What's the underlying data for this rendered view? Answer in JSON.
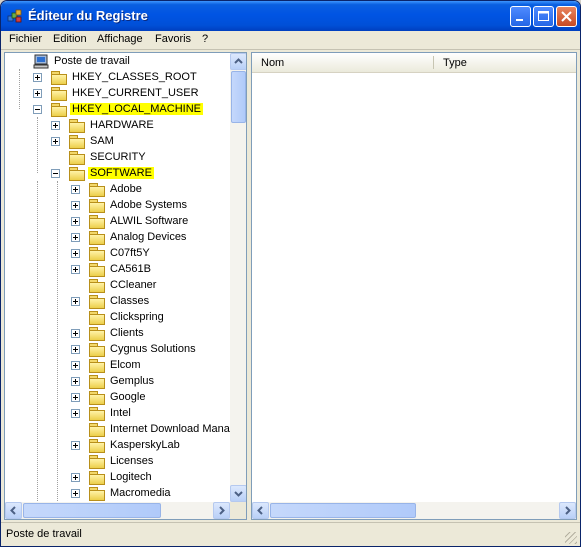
{
  "window": {
    "title": "Éditeur du Registre"
  },
  "menu": [
    "Fichier",
    "Edition",
    "Affichage",
    "Favoris",
    "?"
  ],
  "tree": {
    "root": "Poste de travail",
    "hives": [
      {
        "label": "HKEY_CLASSES_ROOT",
        "expanded": false,
        "highlighted": false
      },
      {
        "label": "HKEY_CURRENT_USER",
        "expanded": false,
        "highlighted": false
      },
      {
        "label": "HKEY_LOCAL_MACHINE",
        "expanded": true,
        "highlighted": true
      }
    ],
    "hklm_children": [
      {
        "label": "HARDWARE",
        "expandable": true,
        "expanded": false,
        "highlighted": false
      },
      {
        "label": "SAM",
        "expandable": true,
        "expanded": false,
        "highlighted": false
      },
      {
        "label": "SECURITY",
        "expandable": false,
        "expanded": false,
        "highlighted": false
      },
      {
        "label": "SOFTWARE",
        "expandable": true,
        "expanded": true,
        "highlighted": true
      }
    ],
    "software_children": [
      {
        "label": "Adobe",
        "expandable": true
      },
      {
        "label": "Adobe Systems",
        "expandable": true
      },
      {
        "label": "ALWIL Software",
        "expandable": true
      },
      {
        "label": "Analog Devices",
        "expandable": true
      },
      {
        "label": "C07ft5Y",
        "expandable": true
      },
      {
        "label": "CA561B",
        "expandable": true
      },
      {
        "label": "CCleaner",
        "expandable": false
      },
      {
        "label": "Classes",
        "expandable": true
      },
      {
        "label": "Clickspring",
        "expandable": false
      },
      {
        "label": "Clients",
        "expandable": true
      },
      {
        "label": "Cygnus Solutions",
        "expandable": true
      },
      {
        "label": "Elcom",
        "expandable": true
      },
      {
        "label": "Gemplus",
        "expandable": true
      },
      {
        "label": "Google",
        "expandable": true
      },
      {
        "label": "Intel",
        "expandable": true
      },
      {
        "label": "Internet Download Manag",
        "expandable": false
      },
      {
        "label": "KasperskyLab",
        "expandable": true
      },
      {
        "label": "Licenses",
        "expandable": false
      },
      {
        "label": "Logitech",
        "expandable": true
      },
      {
        "label": "Macromedia",
        "expandable": true
      }
    ]
  },
  "list": {
    "columns": [
      "Nom",
      "Type"
    ]
  },
  "status": {
    "text": "Poste de travail"
  },
  "colors": {
    "highlight": "#ffff00",
    "titlebar": "#0054e3"
  }
}
